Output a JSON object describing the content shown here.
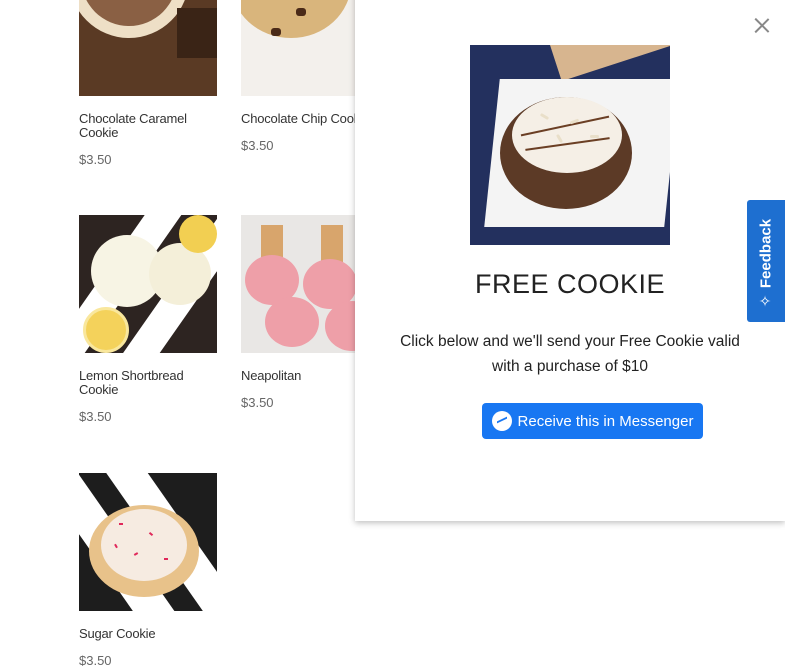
{
  "products": [
    {
      "name": "Chocolate Caramel Cookie",
      "price": "$3.50"
    },
    {
      "name": "Chocolate Chip Cookie",
      "price": "$3.50"
    },
    {
      "name": "Lemon Shortbread Cookie",
      "price": "$3.50"
    },
    {
      "name": "Neapolitan",
      "price": "$3.50"
    },
    {
      "name": "Sugar Cookie",
      "price": "$3.50"
    }
  ],
  "modal": {
    "title": "FREE COOKIE",
    "description": "Click below and we'll send your Free Cookie valid with a purchase of $10",
    "button_label": "Receive this in Messenger",
    "close_icon": "close-icon",
    "button_color": "#1877f2"
  },
  "feedback": {
    "label": "Feedback",
    "color": "#1e6fd0"
  }
}
